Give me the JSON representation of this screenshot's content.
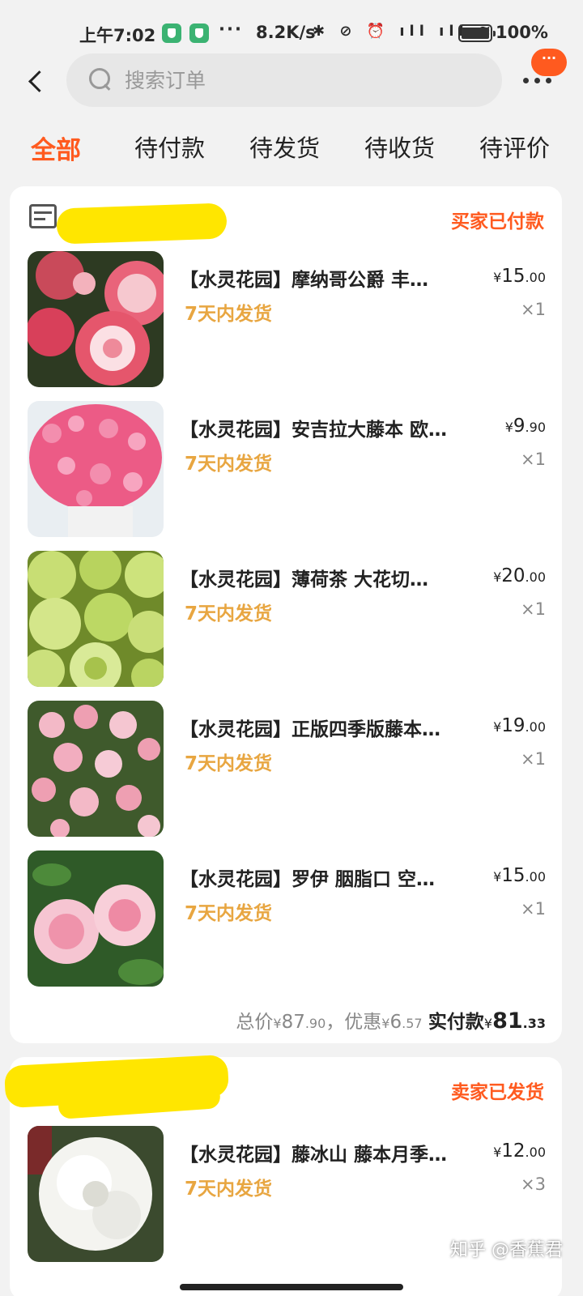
{
  "status_bar": {
    "time": "上午7:02",
    "dots": "···",
    "speed": "8.2K/s",
    "sys_icons": "✱ ⊘ ⏰ ıll ıll ≋",
    "battery": "100%"
  },
  "search": {
    "placeholder": "搜索订单"
  },
  "header": {
    "message_badge": "···"
  },
  "tabs": [
    {
      "label": "全部",
      "active": true
    },
    {
      "label": "待付款"
    },
    {
      "label": "待发货"
    },
    {
      "label": "待收货"
    },
    {
      "label": "待评价"
    }
  ],
  "orders": [
    {
      "status": "买家已付款",
      "items": [
        {
          "title": "【水灵花园】摩纳哥公爵  丰…",
          "price_int": "15",
          "price_dec": ".00",
          "ship": "7天内发货",
          "qty": "×1"
        },
        {
          "title": "【水灵花园】安吉拉大藤本 欧…",
          "price_int": "9",
          "price_dec": ".90",
          "ship": "7天内发货",
          "qty": "×1"
        },
        {
          "title": "【水灵花园】薄荷茶 大花切…",
          "price_int": "20",
          "price_dec": ".00",
          "ship": "7天内发货",
          "qty": "×1"
        },
        {
          "title": "【水灵花园】正版四季版藤本…",
          "price_int": "19",
          "price_dec": ".00",
          "ship": "7天内发货",
          "qty": "×1"
        },
        {
          "title": "【水灵花园】罗伊 胭脂口  空…",
          "price_int": "15",
          "price_dec": ".00",
          "ship": "7天内发货",
          "qty": "×1"
        }
      ],
      "summary": {
        "total_label": "总价",
        "total_int": "87",
        "total_dec": ".90",
        "discount_label": "，优惠",
        "discount_int": "6",
        "discount_dec": ".57",
        "paid_label": "实付款",
        "paid_int": "81",
        "paid_dec": ".33",
        "currency": "¥"
      }
    },
    {
      "status": "卖家已发货",
      "items": [
        {
          "title": "【水灵花园】藤冰山 藤本月季…",
          "price_int": "12",
          "price_dec": ".00",
          "ship": "7天内发货",
          "qty": "×3"
        }
      ]
    }
  ],
  "watermark": "知乎 @香蕉君",
  "colors": {
    "accent": "#ff5a1f",
    "ship_note": "#e8a641",
    "background": "#f2f2f2"
  }
}
